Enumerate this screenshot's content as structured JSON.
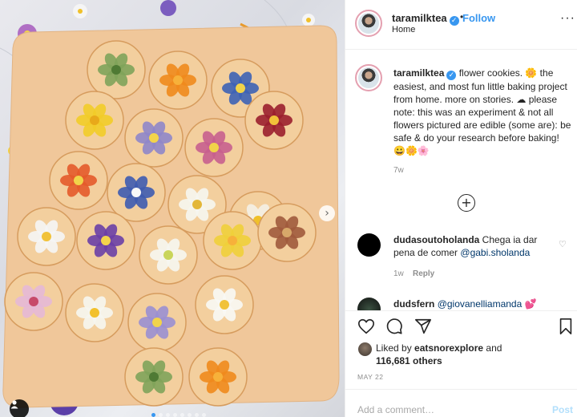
{
  "post": {
    "username": "taramilktea",
    "verified_badge": "✓",
    "follow_label": "Follow",
    "separator": "•",
    "location": "Home",
    "more_label": "···"
  },
  "caption": {
    "username": "taramilktea",
    "text": " flower cookies. 🌼 the easiest, and most fun little baking project from home. more on stories. ☁ please note: this was an experiment & not all flowers pictured are edible (some are): be safe & do your research before baking! 😀🌼🌸",
    "age": "7w"
  },
  "load_more_label": "+",
  "comments": [
    {
      "username": "dudasoutoholanda",
      "text": " Chega ia dar pena de comer ",
      "mention": "@gabi.sholanda",
      "age": "1w",
      "reply_label": "Reply"
    },
    {
      "username": "dudsfern",
      "text": " ",
      "mention": "@giovanelliamanda 💕"
    }
  ],
  "likes": {
    "prefix": "Liked by ",
    "user": "eatsnorexplore",
    "and": " and",
    "count": "116,681 others"
  },
  "date": "MAY 22",
  "add_comment": {
    "placeholder": "Add a comment…",
    "post_label": "Post"
  },
  "carousel": {
    "next_label": "›",
    "slide_count": 8,
    "current_slide": 1
  },
  "icons": [
    "heart-icon",
    "comment-icon",
    "share-icon",
    "bookmark-icon",
    "tag-user-icon",
    "chevron-right-icon",
    "plus-circle-icon",
    "verified-icon"
  ],
  "colors": {
    "accent": "#3897f0",
    "post_disabled": "#b2dffc",
    "muted": "#8e8e8e"
  }
}
